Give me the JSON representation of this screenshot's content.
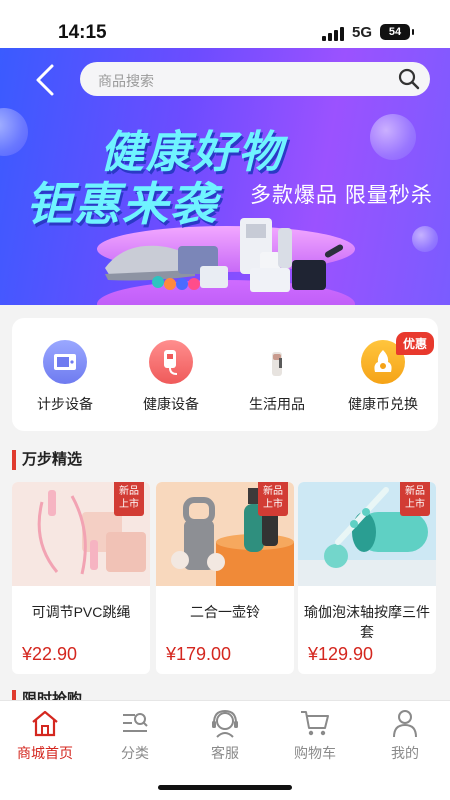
{
  "status_bar": {
    "time": "14:15",
    "network": "5G",
    "battery": "54"
  },
  "header": {
    "search_placeholder": "商品搜索"
  },
  "banner": {
    "title_line1": "健康好物",
    "title_line2": "钜惠来袭",
    "subtitle": "多款爆品 限量秒杀"
  },
  "categories": [
    {
      "label": "计步设备",
      "icon": "pedometer-icon"
    },
    {
      "label": "健康设备",
      "icon": "health-device-icon"
    },
    {
      "label": "生活用品",
      "icon": "daily-goods-icon"
    },
    {
      "label": "健康币兑换",
      "icon": "coin-exchange-icon"
    }
  ],
  "promo_badge": "优惠",
  "section": {
    "title": "万步精选",
    "next_title": "限时抢购"
  },
  "products": [
    {
      "name": "可调节PVC跳绳",
      "price": "¥22.90",
      "tag": "新品上市"
    },
    {
      "name": "二合一壶铃",
      "price": "¥179.00",
      "tag": "新品上市"
    },
    {
      "name": "瑜伽泡沫轴按摩三件套",
      "price": "¥129.90",
      "tag": "新品上市"
    }
  ],
  "tabbar": [
    {
      "label": "商城首页",
      "icon": "home-icon",
      "active": true
    },
    {
      "label": "分类",
      "icon": "category-icon",
      "active": false
    },
    {
      "label": "客服",
      "icon": "customer-service-icon",
      "active": false
    },
    {
      "label": "购物车",
      "icon": "cart-icon",
      "active": false
    },
    {
      "label": "我的",
      "icon": "user-icon",
      "active": false
    }
  ],
  "colors": {
    "accent": "#d4271f",
    "banner_start": "#3a5bff",
    "banner_end": "#9b52ff"
  }
}
